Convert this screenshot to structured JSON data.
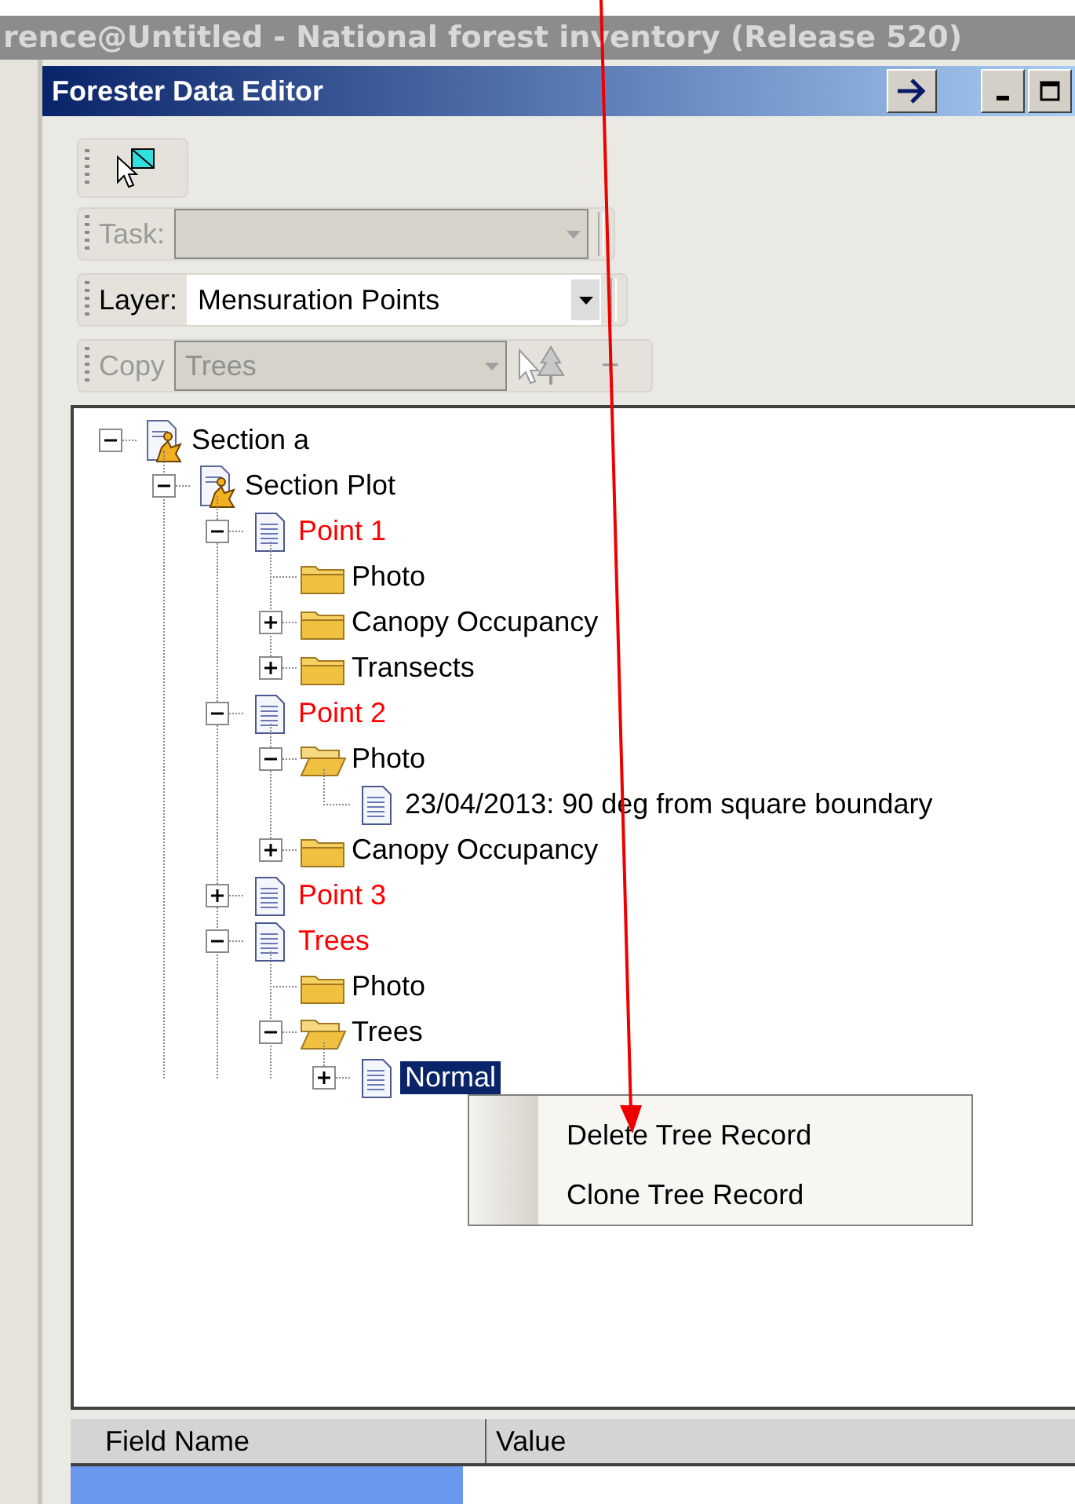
{
  "background_window": {
    "title": "rence@Untitled - National forest inventory (Release 520)"
  },
  "window": {
    "title": "Forester Data Editor"
  },
  "toolbars": [
    {
      "kind": "combo",
      "label": "Task:",
      "disabled": true
    },
    {
      "kind": "combo",
      "label": "Layer:",
      "value": "Mensuration Points",
      "disabled": false
    },
    {
      "kind": "copy",
      "label": "Copy",
      "value": "Trees",
      "disabled": true,
      "add_button": "+"
    }
  ],
  "tree": [
    {
      "label": "Section a",
      "kind": "section",
      "expanded": true,
      "color": "#000000",
      "selected": false,
      "children": [
        {
          "label": "Section Plot",
          "kind": "section",
          "expanded": true,
          "color": "#000000",
          "selected": false,
          "children": [
            {
              "label": "Point 1",
              "kind": "document",
              "expanded": true,
              "color": "#ff0000",
              "selected": false,
              "children": [
                {
                  "label": "Photo",
                  "kind": "folder",
                  "color": "#000000",
                  "selected": false
                },
                {
                  "label": "Canopy Occupancy",
                  "kind": "folder",
                  "expanded": false,
                  "color": "#000000",
                  "selected": false
                },
                {
                  "label": "Transects",
                  "kind": "folder",
                  "expanded": false,
                  "color": "#000000",
                  "selected": false
                }
              ]
            },
            {
              "label": "Point 2",
              "kind": "document",
              "expanded": true,
              "color": "#ff0000",
              "selected": false,
              "children": [
                {
                  "label": "Photo",
                  "kind": "folder",
                  "expanded": true,
                  "color": "#000000",
                  "selected": false,
                  "children": [
                    {
                      "label": "23/04/2013: 90 deg from square boundary",
                      "kind": "document",
                      "color": "#000000",
                      "selected": false
                    }
                  ]
                },
                {
                  "label": "Canopy Occupancy",
                  "kind": "folder",
                  "expanded": false,
                  "color": "#000000",
                  "selected": false
                }
              ]
            },
            {
              "label": "Point 3",
              "kind": "document",
              "expanded": false,
              "color": "#ff0000",
              "selected": false
            },
            {
              "label": "Trees",
              "kind": "document",
              "expanded": true,
              "color": "#ff0000",
              "selected": false,
              "children": [
                {
                  "label": "Photo",
                  "kind": "folder",
                  "color": "#000000",
                  "selected": false
                },
                {
                  "label": "Trees",
                  "kind": "folder",
                  "expanded": true,
                  "color": "#000000",
                  "selected": false,
                  "children": [
                    {
                      "label": "Normal",
                      "kind": "document",
                      "expanded": false,
                      "selected": true
                    }
                  ]
                }
              ]
            }
          ]
        }
      ]
    }
  ],
  "context_menu": {
    "items": [
      {
        "label": "Delete Tree Record"
      },
      {
        "label": "Clone Tree Record"
      }
    ]
  },
  "grid": {
    "columns": [
      "Field Name",
      "Value"
    ]
  }
}
